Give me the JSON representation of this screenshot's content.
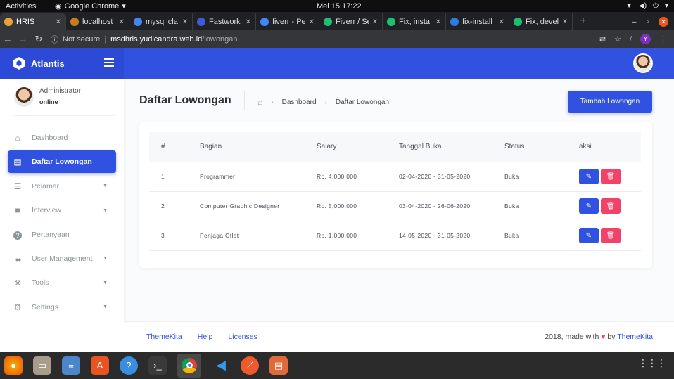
{
  "os": {
    "activities": "Activities",
    "app_name": "Google Chrome",
    "clock": "Mei 15  17:22"
  },
  "browser": {
    "tabs": [
      {
        "title": "HRIS",
        "active": true,
        "color": "#e9a23b"
      },
      {
        "title": "localhost",
        "active": false,
        "color": "#c77c1d"
      },
      {
        "title": "mysql cla",
        "active": false,
        "color": "#4285f4"
      },
      {
        "title": "Fastwork",
        "active": false,
        "color": "#3b5bdb"
      },
      {
        "title": "fiverr - Pe",
        "active": false,
        "color": "#4285f4"
      },
      {
        "title": "Fiverr / Se",
        "active": false,
        "color": "#1dbf73"
      },
      {
        "title": "Fix, insta",
        "active": false,
        "color": "#1dbf73"
      },
      {
        "title": "fix-install",
        "active": false,
        "color": "#2d7ae0"
      },
      {
        "title": "Fix, devel",
        "active": false,
        "color": "#1dbf73"
      }
    ],
    "security": "Not secure",
    "host": "msdhris.yudicandra.web.id",
    "path": "/lowongan",
    "profile_initial": "Y"
  },
  "app": {
    "brand": "Atlantis",
    "accent": "#3152e0"
  },
  "sidebar": {
    "user_name": "Administrator",
    "user_status": "online",
    "items": [
      {
        "label": "Dashboard",
        "icon": "home-icon",
        "active": false,
        "caret": false
      },
      {
        "label": "Daftar Lowongan",
        "icon": "list-icon",
        "active": true,
        "caret": false
      },
      {
        "label": "Pelamar",
        "icon": "list-alt-icon",
        "active": false,
        "caret": true
      },
      {
        "label": "Interview",
        "icon": "square-icon",
        "active": false,
        "caret": true
      },
      {
        "label": "Pertanyaan",
        "icon": "question-icon",
        "active": false,
        "caret": false
      },
      {
        "label": "User Management",
        "icon": "users-icon",
        "active": false,
        "caret": true
      },
      {
        "label": "Tools",
        "icon": "wrench-icon",
        "active": false,
        "caret": true
      },
      {
        "label": "Settings",
        "icon": "cogs-icon",
        "active": false,
        "caret": true
      }
    ]
  },
  "main": {
    "title": "Daftar Lowongan",
    "breadcrumb": [
      "Dashboard",
      "Daftar Lowongan"
    ],
    "add_button": "Tambah Lowongan",
    "table": {
      "headers": [
        "#",
        "Bagian",
        "Salary",
        "Tanggal Buka",
        "Status",
        "aksi"
      ],
      "rows": [
        [
          "1",
          "Programmer",
          "Rp. 4,000,000",
          "02-04-2020 - 31-05-2020",
          "Buka"
        ],
        [
          "2",
          "Computer Graphic Designer",
          "Rp. 5,000,000",
          "03-04-2020 - 26-06-2020",
          "Buka"
        ],
        [
          "3",
          "Penjaga Otlet",
          "Rp. 1,000,000",
          "14-05-2020 - 31-05-2020",
          "Buka"
        ]
      ]
    }
  },
  "footer": {
    "links": [
      "ThemeKita",
      "Help",
      "Licenses"
    ],
    "credit_prefix": "2018, made with",
    "credit_by": "by",
    "credit_brand": "ThemeKita"
  }
}
